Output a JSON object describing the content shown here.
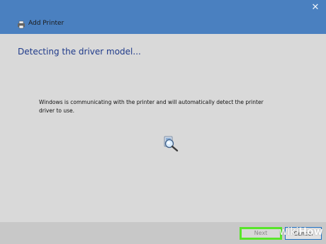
{
  "dialog": {
    "title": "Add Printer",
    "close_glyph": "✕",
    "heading": "Detecting the driver model...",
    "message": "Windows is communicating with the printer and will automatically detect the printer driver to use."
  },
  "buttons": {
    "next": "Next",
    "cancel": "Cancel"
  },
  "watermark": {
    "wiki": "wiki",
    "how": "How"
  },
  "colors": {
    "title_bar": "#4a80c0",
    "heading": "#1f3a8a",
    "highlight": "#58e52a"
  },
  "icons": [
    "close-icon",
    "printer-icon",
    "search-printer-icon"
  ]
}
